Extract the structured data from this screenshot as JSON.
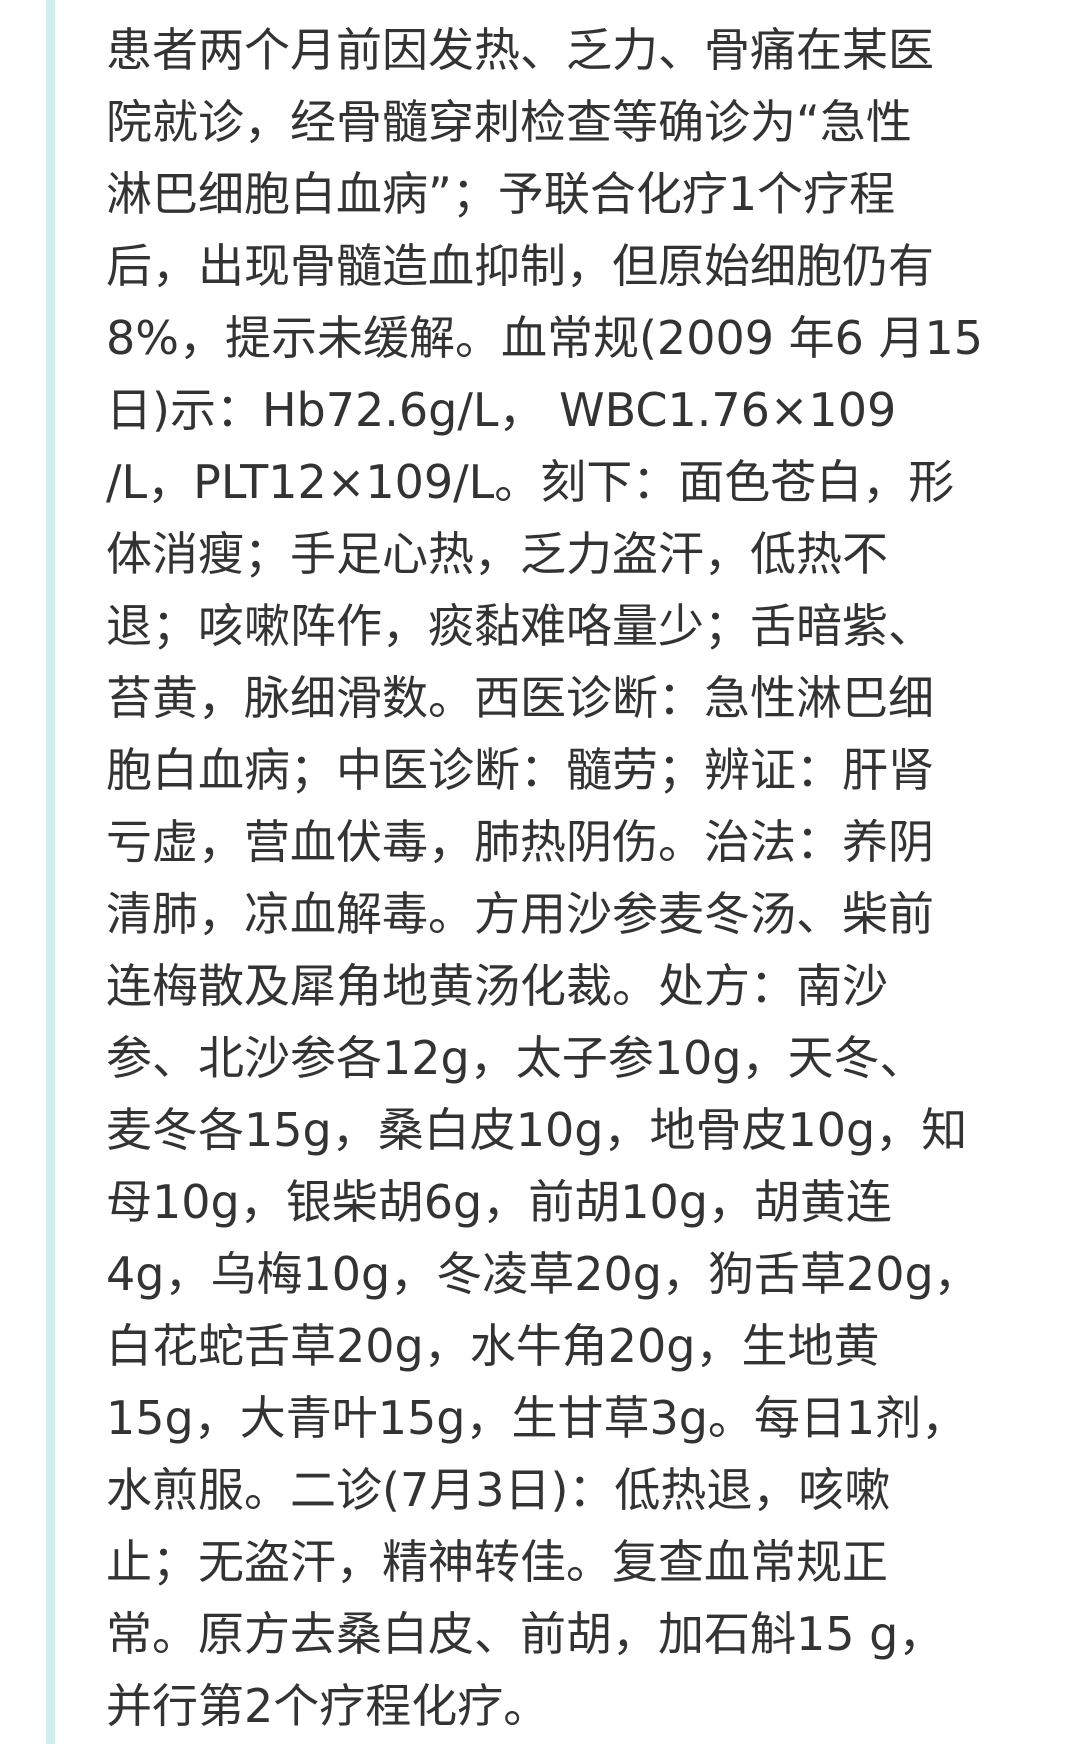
{
  "colors": {
    "background": "#ffffff",
    "text": "#333333",
    "left_rule": "#d3ecee"
  },
  "article": {
    "lines": [
      "患者两个月前因发热、乏力、骨痛在某医",
      "院就诊，经骨髓穿刺检查等确诊为“急性",
      "淋巴细胞白血病”；予联合化疗1个疗程",
      "后，出现骨髓造血抑制，但原始细胞仍有",
      "8%，提示未缓解。血常规(2009 年6 月15",
      "日)示：Hb72.6g/L， WBC1.76×109",
      "/L，PLT12×109/L。刻下：面色苍白，形",
      "体消瘦；手足心热，乏力盗汗，低热不",
      "退；咳嗽阵作，痰黏难咯量少；舌暗紫、",
      "苔黄，脉细滑数。西医诊断：急性淋巴细",
      "胞白血病；中医诊断：髓劳；辨证：肝肾",
      "亏虚，营血伏毒，肺热阴伤。治法：养阴",
      "清肺，凉血解毒。方用沙参麦冬汤、柴前",
      "连梅散及犀角地黄汤化裁。处方：南沙",
      "参、北沙参各12g，太子参10g，天冬、",
      "麦冬各15g，桑白皮10g，地骨皮10g，知",
      "母10g，银柴胡6g，前胡10g，胡黄连",
      "4g，乌梅10g，冬凌草20g，狗舌草20g，",
      "白花蛇舌草20g，水牛角20g，生地黄",
      "15g，大青叶15g，生甘草3g。每日1剂，",
      "水煎服。二诊(7月3日)：低热退，咳嗽",
      "止；无盗汗，精神转佳。复查血常规正",
      "常。原方去桑白皮、前胡，加石斛15 g，",
      "并行第2个疗程化疗。"
    ]
  }
}
